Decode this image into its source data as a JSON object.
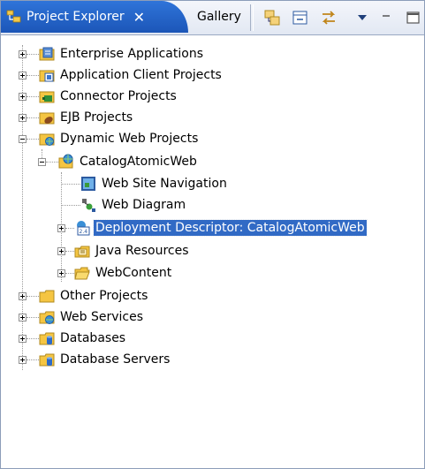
{
  "tabs": {
    "active_label": "Project Explorer",
    "close_glyph": "✕",
    "inactive_label": "Gallery"
  },
  "toolbar": {
    "buttons": [
      "link-with-editor-icon",
      "collapse-all-icon",
      "sync-arrows-icon",
      "view-menu-icon",
      "minimize-icon"
    ]
  },
  "tree": {
    "items": [
      {
        "label": "Enterprise Applications",
        "icon": "enterprise-app-icon",
        "expanded": false
      },
      {
        "label": "Application Client Projects",
        "icon": "app-client-icon",
        "expanded": false
      },
      {
        "label": "Connector Projects",
        "icon": "connector-icon",
        "expanded": false
      },
      {
        "label": "EJB Projects",
        "icon": "ejb-icon",
        "expanded": false
      },
      {
        "label": "Dynamic Web Projects",
        "icon": "web-folder-icon",
        "expanded": true
      },
      {
        "label": "CatalogAtomicWeb",
        "icon": "web-project-icon",
        "expanded": true
      },
      {
        "label": "Web Site Navigation",
        "icon": "site-nav-icon",
        "expanded": null
      },
      {
        "label": "Web Diagram",
        "icon": "web-diagram-icon",
        "expanded": null
      },
      {
        "label": "Deployment Descriptor: CatalogAtomicWeb",
        "icon": "deployment-descriptor-icon",
        "expanded": false,
        "selected": true
      },
      {
        "label": "Java Resources",
        "icon": "java-resources-icon",
        "expanded": false
      },
      {
        "label": "WebContent",
        "icon": "webcontent-folder-icon",
        "expanded": false
      },
      {
        "label": "Other Projects",
        "icon": "folder-icon",
        "expanded": false
      },
      {
        "label": "Web Services",
        "icon": "web-services-icon",
        "expanded": false
      },
      {
        "label": "Databases",
        "icon": "databases-icon",
        "expanded": false
      },
      {
        "label": "Database Servers",
        "icon": "database-servers-icon",
        "expanded": false
      }
    ]
  },
  "colors": {
    "tab_active": "#1c56b8",
    "selection": "#316ac5",
    "folder": "#f5c542",
    "border": "#8c9db9"
  }
}
